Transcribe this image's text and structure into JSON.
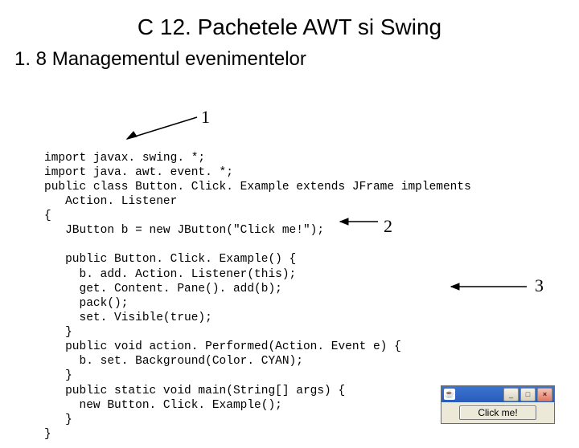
{
  "title": "C 12. Pachetele AWT si Swing",
  "subtitle": "1. 8 Managementul evenimentelor",
  "annotations": {
    "a1": "1",
    "a2": "2",
    "a3": "3"
  },
  "code": "import javax. swing. *;\nimport java. awt. event. *;\npublic class Button. Click. Example extends JFrame implements\n   Action. Listener\n{\n   JButton b = new JButton(\"Click me!\");\n\n   public Button. Click. Example() {\n     b. add. Action. Listener(this);\n     get. Content. Pane(). add(b);\n     pack();\n     set. Visible(true);\n   }\n   public void action. Performed(Action. Event e) {\n     b. set. Background(Color. CYAN);\n   }\n   public static void main(String[] args) {\n     new Button. Click. Example();\n   }\n}",
  "window": {
    "icon_glyph": "☕",
    "min_glyph": "_",
    "max_glyph": "□",
    "close_glyph": "×",
    "button_label": "Click me!"
  }
}
